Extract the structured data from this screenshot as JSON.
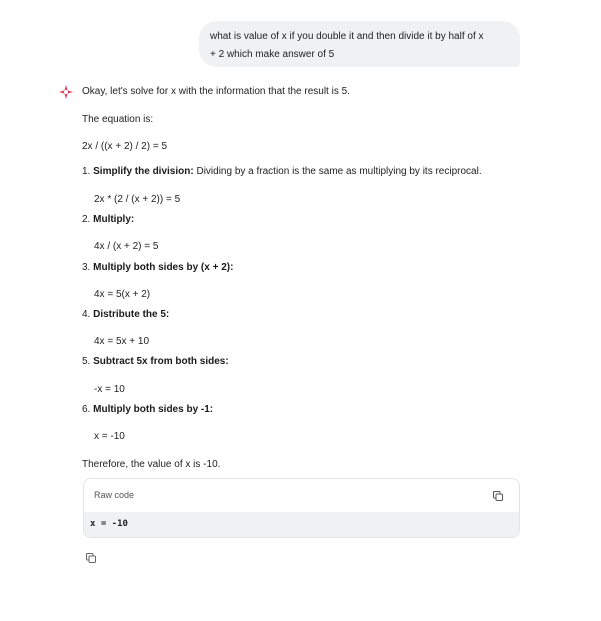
{
  "user_message": {
    "line1": "what is value of x if you double it and then divide it by half of x",
    "line2": "+ 2 which make answer of 5"
  },
  "assistant": {
    "intro": "Okay, let's solve for x with the information that the result is 5.",
    "equation_label": "The equation is:",
    "equation": "2x / ((x + 2) / 2) = 5",
    "steps": [
      {
        "number": "1.",
        "title": "Simplify the division:",
        "desc": " Dividing by a fraction is the same as multiplying by its reciprocal.",
        "expr": "2x * (2 / (x + 2)) = 5"
      },
      {
        "number": "2.",
        "title": "Multiply:",
        "desc": "",
        "expr": "4x / (x + 2) = 5"
      },
      {
        "number": "3.",
        "title": "Multiply both sides by (x + 2):",
        "desc": "",
        "expr": "4x = 5(x + 2)"
      },
      {
        "number": "4.",
        "title": "Distribute the 5:",
        "desc": "",
        "expr": "4x = 5x + 10"
      },
      {
        "number": "5.",
        "title": "Subtract 5x from both sides:",
        "desc": "",
        "expr": "-x = 10"
      },
      {
        "number": "6.",
        "title": "Multiply both sides by -1:",
        "desc": "",
        "expr": "x = -10"
      }
    ],
    "conclusion": "Therefore, the value of x is -10.",
    "code_block": {
      "title": "Raw code",
      "code": "x = -10"
    }
  },
  "icons": {
    "assistant": "sparkle-icon",
    "copy": "copy-icon"
  },
  "colors": {
    "sparkle": "#e8385c",
    "bubble": "#f0f1f3",
    "code_bg": "#f0f1f3"
  }
}
